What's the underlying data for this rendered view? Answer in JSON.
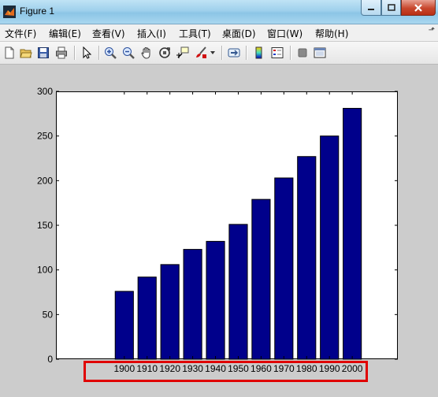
{
  "window": {
    "title": "Figure 1"
  },
  "menu": [
    {
      "label": "文件(F)"
    },
    {
      "label": "编辑(E)"
    },
    {
      "label": "查看(V)"
    },
    {
      "label": "插入(I)"
    },
    {
      "label": "工具(T)"
    },
    {
      "label": "桌面(D)"
    },
    {
      "label": "窗口(W)"
    },
    {
      "label": "帮助(H)"
    }
  ],
  "toolbar": {
    "icons": [
      "new-file-icon",
      "open-folder-icon",
      "save-icon",
      "print-icon",
      "pointer-icon",
      "zoom-in-icon",
      "zoom-out-icon",
      "pan-hand-icon",
      "rotate-3d-icon",
      "data-cursor-icon",
      "brush-icon",
      "link-icon",
      "colorbar-icon",
      "legend-icon",
      "hide-plot-tools-icon",
      "show-plot-tools-icon"
    ]
  },
  "colors": {
    "bar": "#00008b",
    "highlight": "#e00000"
  },
  "chart_data": {
    "type": "bar",
    "categories": [
      "1900",
      "1910",
      "1920",
      "1930",
      "1940",
      "1950",
      "1960",
      "1970",
      "1980",
      "1990",
      "2000"
    ],
    "values": [
      76,
      92,
      106,
      123,
      132,
      151,
      179,
      203,
      227,
      250,
      281
    ],
    "yticks": [
      0,
      50,
      100,
      150,
      200,
      250,
      300
    ],
    "ylim": [
      0,
      300
    ],
    "xlim": [
      -2,
      13
    ],
    "grid": false
  }
}
